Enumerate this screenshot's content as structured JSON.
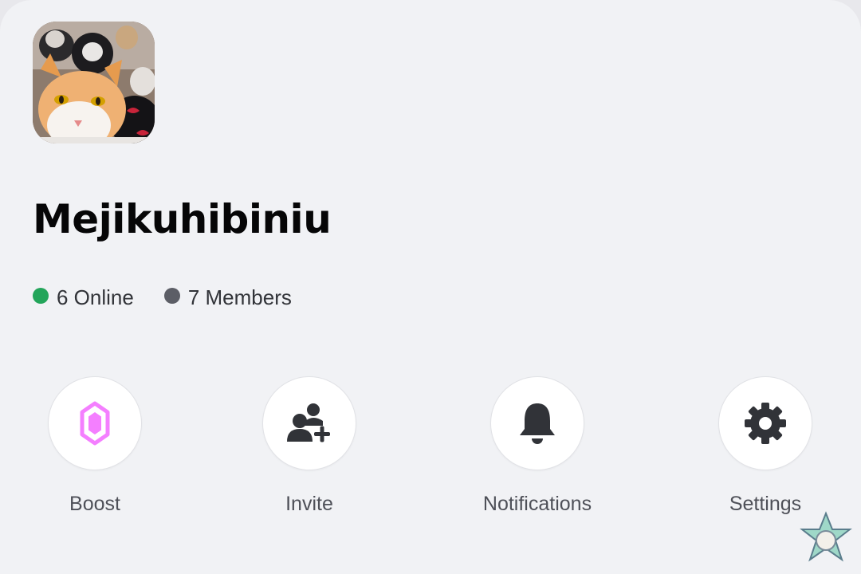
{
  "server": {
    "name": "Mejikuhibiniu",
    "icon": "cat-photo-avatar"
  },
  "stats": {
    "online_label": "6 Online",
    "members_label": "7 Members",
    "online_color": "#23a55a",
    "members_color": "#5c5e66"
  },
  "actions": [
    {
      "label": "Boost",
      "icon": "boost-gem-icon",
      "color": "#f47fff"
    },
    {
      "label": "Invite",
      "icon": "add-user-icon",
      "color": "#313338"
    },
    {
      "label": "Notifications",
      "icon": "bell-icon",
      "color": "#313338"
    },
    {
      "label": "Settings",
      "icon": "gear-icon",
      "color": "#313338"
    }
  ],
  "colors": {
    "background": "#f1f2f5",
    "text_primary": "#060607",
    "text_secondary": "#4e5058"
  }
}
